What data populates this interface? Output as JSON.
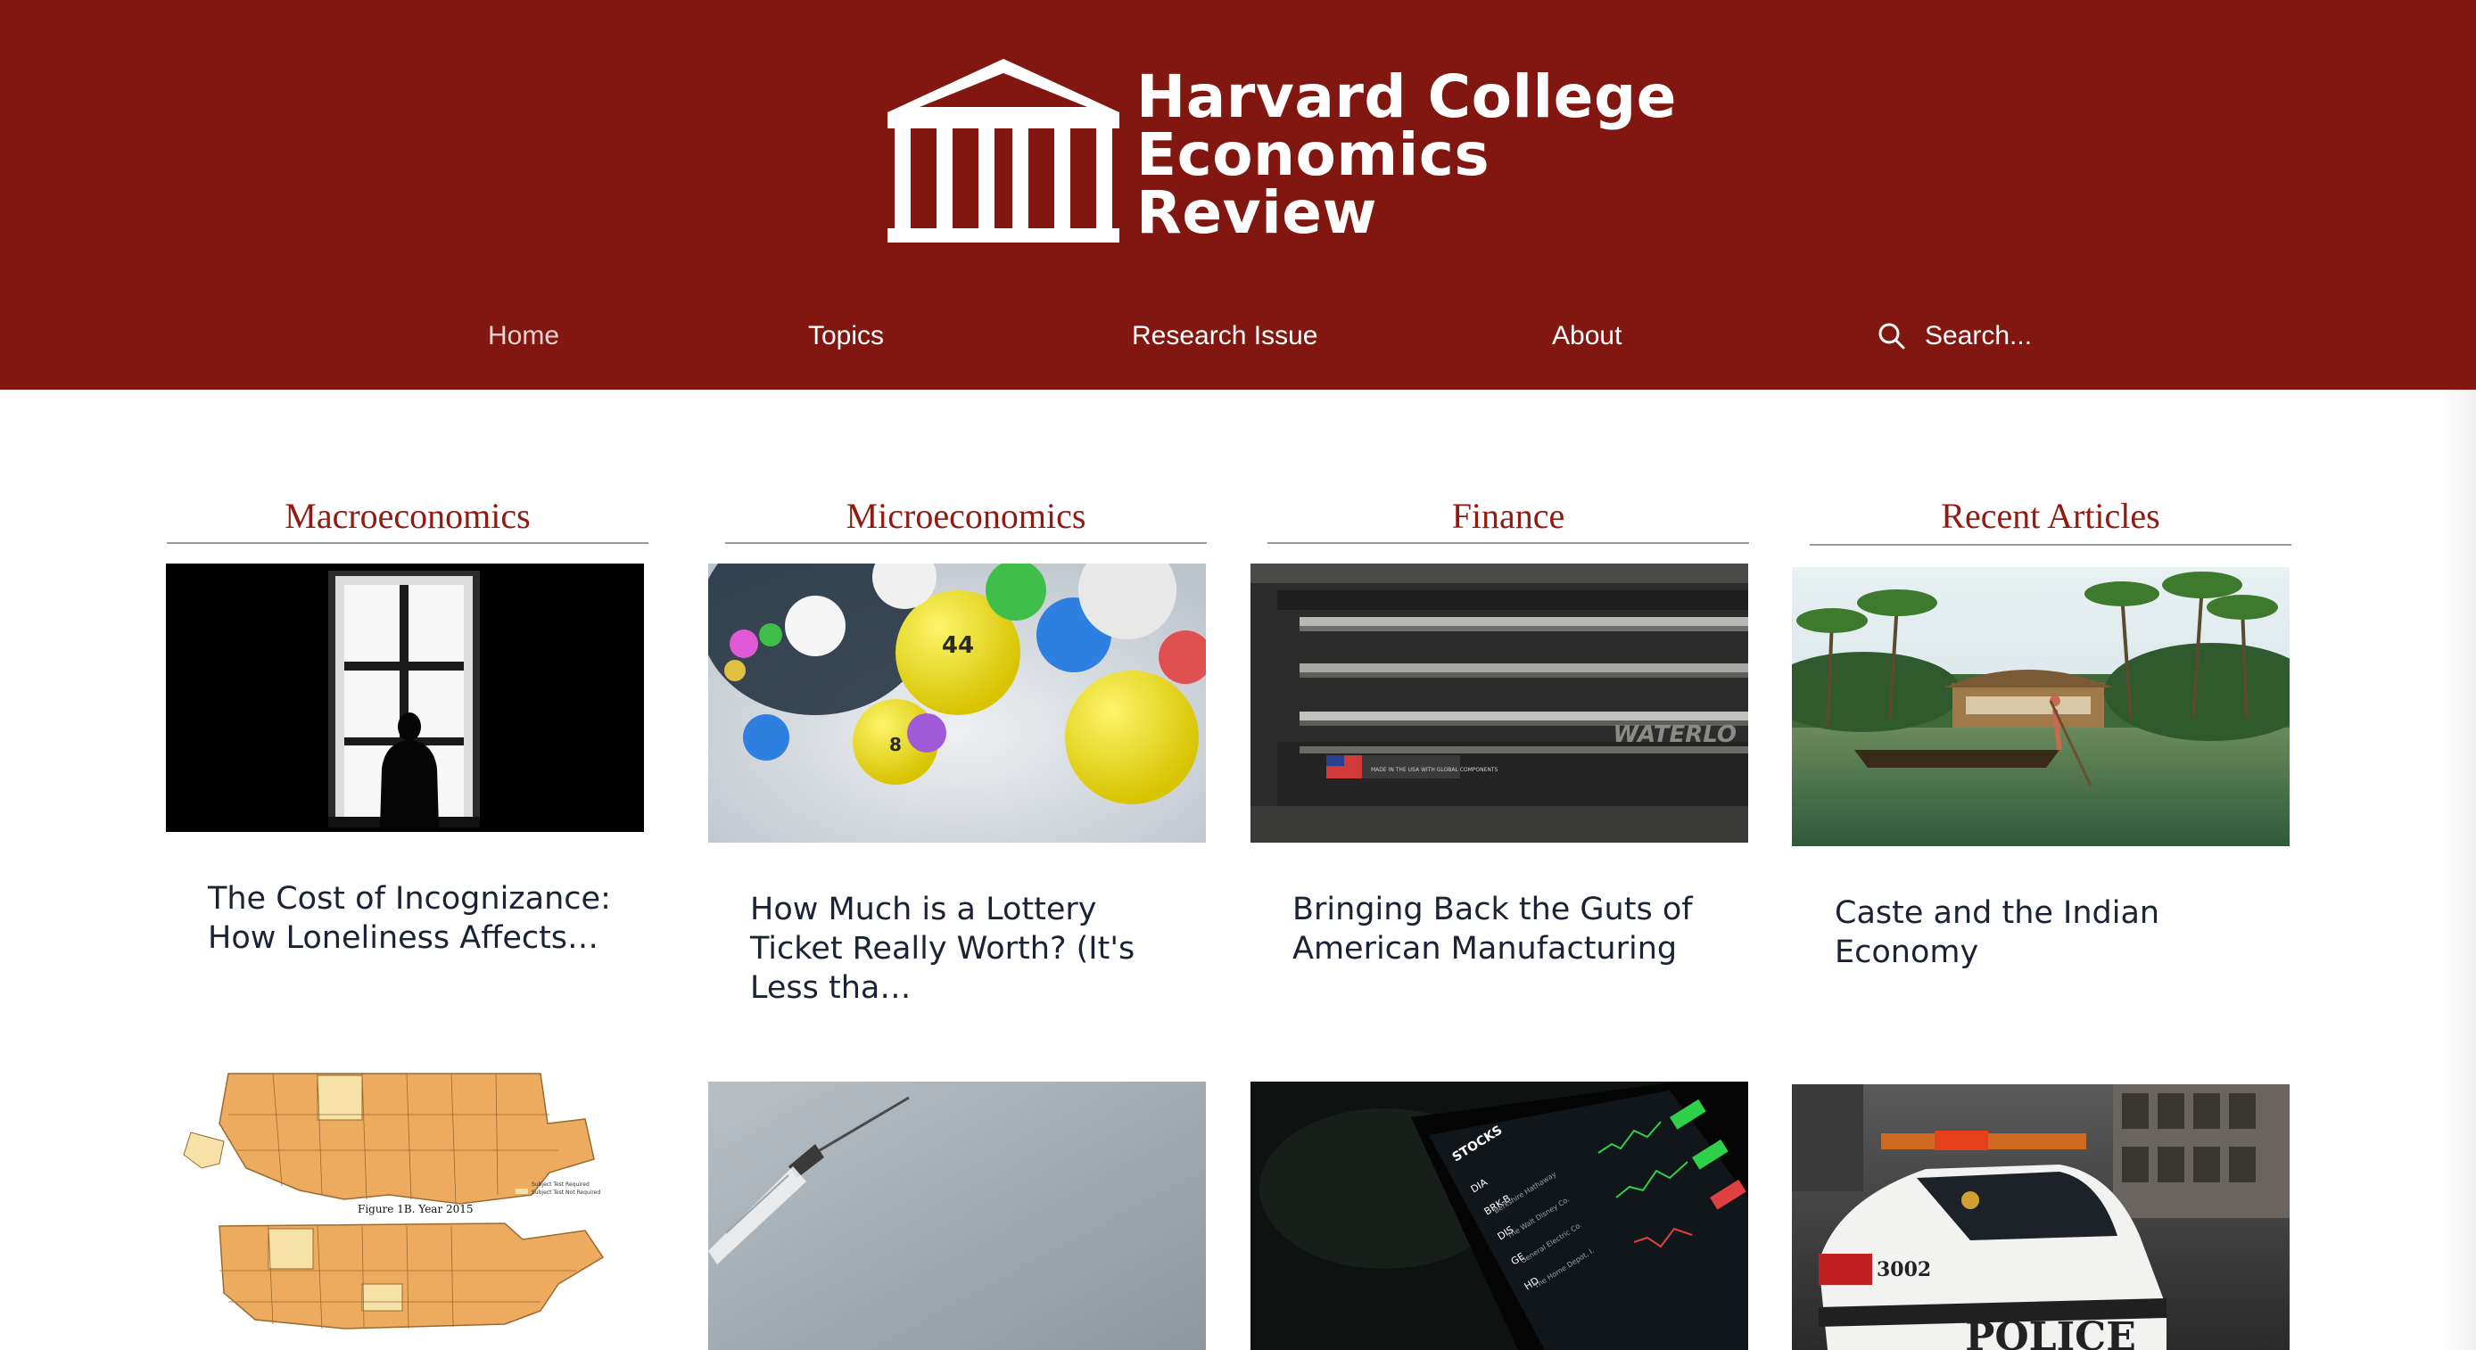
{
  "site": {
    "title_lines": [
      "Harvard College",
      "Economics",
      "Review"
    ],
    "logo_icon": "columned-building-icon",
    "header_bg": "#811710",
    "accent": "#8f1b12"
  },
  "nav": {
    "items": [
      {
        "label": "Home",
        "active": true
      },
      {
        "label": "Topics",
        "active": false
      },
      {
        "label": "Research Issue",
        "active": false
      },
      {
        "label": "About",
        "active": false
      }
    ],
    "search": {
      "placeholder": "Search...",
      "icon": "search-icon"
    }
  },
  "columns": [
    {
      "heading": "Macroeconomics",
      "articles": [
        {
          "title": "The Cost of Incognizance: How Loneliness Affects…",
          "image": "person-at-window-silhouette"
        },
        {
          "title": "",
          "image": "us-map-figure"
        }
      ]
    },
    {
      "heading": "Microeconomics",
      "articles": [
        {
          "title": "How Much is a Lottery Ticket Really Worth? (It's Less tha…",
          "image": "lottery-balls"
        },
        {
          "title": "",
          "image": "syringe"
        }
      ]
    },
    {
      "heading": "Finance",
      "articles": [
        {
          "title": "Bringing Back the Guts of American Manufacturing",
          "image": "toolbox-drawers"
        },
        {
          "title": "",
          "image": "stock-ticker-phone"
        }
      ]
    },
    {
      "heading": "Recent Articles",
      "articles": [
        {
          "title": "Caste and the Indian Economy",
          "image": "houseboat-backwaters"
        },
        {
          "title": "",
          "image": "police-car"
        }
      ]
    }
  ],
  "image_text": {
    "map_caption": "Figure 1B. Year 2015",
    "map_legend": [
      "Subject Test Required",
      "Subject Test Not Required"
    ],
    "toolbox_brand": "WATERLO",
    "toolbox_label": "MADE IN THE USA WITH GLOBAL COMPONENTS",
    "phone_header": "STOCKS",
    "phone_rows": [
      "DIA",
      "BRK-B",
      "DIS",
      "GE",
      "HD"
    ],
    "phone_rows_sub": [
      "Berkshire Hathaway",
      "The Walt Disney Co.",
      "General Electric Co.",
      "The Home Depot, I."
    ],
    "police_number": "3002",
    "police_text": "POLICE"
  }
}
